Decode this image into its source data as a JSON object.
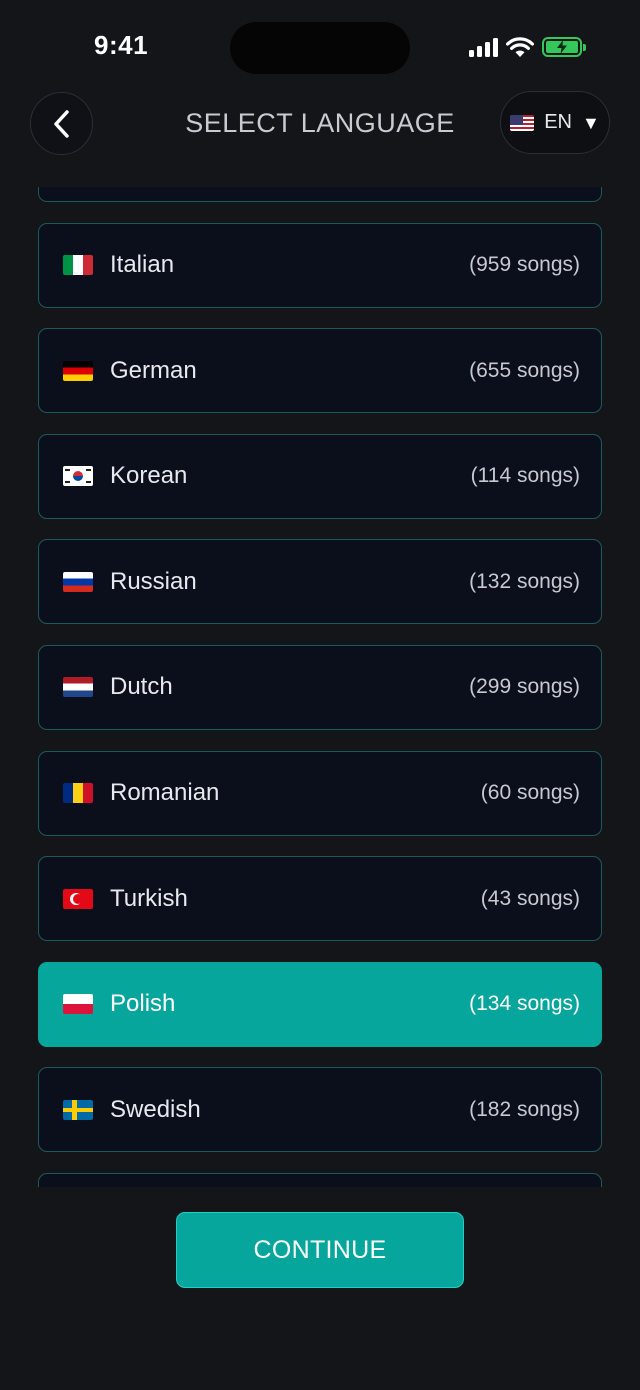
{
  "status_bar": {
    "time": "9:41",
    "icons": [
      "cellular-signal-icon",
      "wifi-icon",
      "battery-charging-icon"
    ],
    "battery_color": "#34c759"
  },
  "header": {
    "title": "SELECT LANGUAGE",
    "back_icon": "chevron-left-icon",
    "language_selector": {
      "flag": "us-flag-icon",
      "code": "EN",
      "caret": "▼"
    }
  },
  "languages": [
    {
      "name": "",
      "count": "",
      "flag": "flag-it",
      "selected": false,
      "partial": true
    },
    {
      "name": "Italian",
      "count": "(959 songs)",
      "flag": "flag-it",
      "selected": false
    },
    {
      "name": "German",
      "count": "(655 songs)",
      "flag": "flag-de",
      "selected": false
    },
    {
      "name": "Korean",
      "count": "(114 songs)",
      "flag": "flag-kr",
      "selected": false
    },
    {
      "name": "Russian",
      "count": "(132 songs)",
      "flag": "flag-ru",
      "selected": false
    },
    {
      "name": "Dutch",
      "count": "(299 songs)",
      "flag": "flag-nl",
      "selected": false
    },
    {
      "name": "Romanian",
      "count": "(60 songs)",
      "flag": "flag-ro",
      "selected": false
    },
    {
      "name": "Turkish",
      "count": "(43 songs)",
      "flag": "flag-tr",
      "selected": false
    },
    {
      "name": "Polish",
      "count": "(134 songs)",
      "flag": "flag-pl",
      "selected": true
    },
    {
      "name": "Swedish",
      "count": "(182 songs)",
      "flag": "flag-se",
      "selected": false
    },
    {
      "name": "",
      "count": "",
      "flag": "flag-se",
      "selected": false,
      "partial": true
    }
  ],
  "colors": {
    "background": "#141519",
    "row_background": "#0b0f1c",
    "row_border": "#1c5a5a",
    "accent": "#07a69d"
  },
  "continue_label": "CONTINUE"
}
